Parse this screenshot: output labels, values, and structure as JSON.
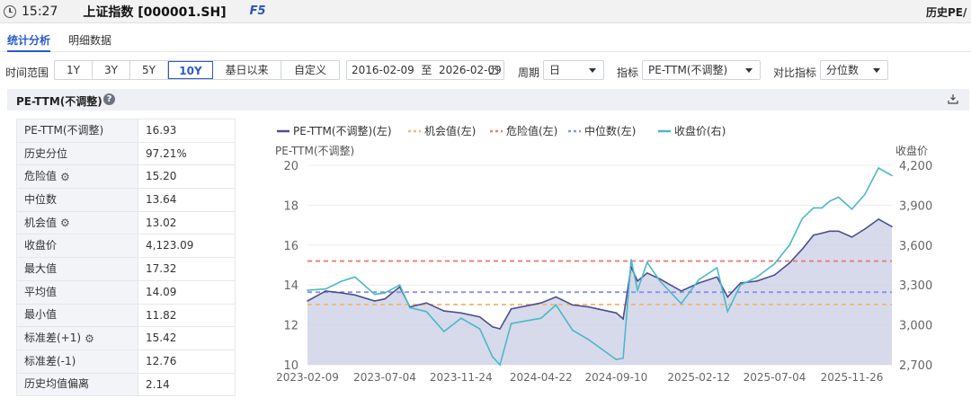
{
  "titlebar": {
    "time": "15:27",
    "stock": "上证指数 [000001.SH]",
    "fkey": "F5",
    "right_text": "历史PE/"
  },
  "tabs": [
    {
      "label": "统计分析",
      "active": true
    },
    {
      "label": "明细数据",
      "active": false
    }
  ],
  "filters": {
    "range_label": "时间范围",
    "ranges": [
      {
        "label": "1Y",
        "active": false
      },
      {
        "label": "3Y",
        "active": false
      },
      {
        "label": "5Y",
        "active": false
      },
      {
        "label": "10Y",
        "active": true
      },
      {
        "label": "基日以来",
        "active": false
      },
      {
        "label": "自定义",
        "active": false
      }
    ],
    "date_range": "2016-02-09  至  2026-02-09",
    "period_label": "周期",
    "period_value": "日",
    "indicator_label": "指标",
    "indicator_value": "PE-TTM(不调整)",
    "compare_label": "对比指标",
    "compare_value": "分位数"
  },
  "panel": {
    "title": "PE-TTM(不调整)"
  },
  "stats": [
    {
      "key": "PE-TTM(不调整)",
      "value": "16.93",
      "gear": false
    },
    {
      "key": "历史分位",
      "value": "97.21%",
      "gear": false
    },
    {
      "key": "危险值",
      "value": "15.20",
      "gear": true
    },
    {
      "key": "中位数",
      "value": "13.64",
      "gear": false
    },
    {
      "key": "机会值",
      "value": "13.02",
      "gear": true
    },
    {
      "key": "收盘价",
      "value": "4,123.09",
      "gear": false
    },
    {
      "key": "最大值",
      "value": "17.32",
      "gear": false
    },
    {
      "key": "平均值",
      "value": "14.09",
      "gear": false
    },
    {
      "key": "最小值",
      "value": "11.82",
      "gear": false
    },
    {
      "key": "标准差(+1)",
      "value": "15.42",
      "gear": true
    },
    {
      "key": "标准差(-1)",
      "value": "12.76",
      "gear": false
    },
    {
      "key": "历史均值偏离",
      "value": "2.14",
      "gear": false
    }
  ],
  "chart_data": {
    "type": "line",
    "legend": [
      {
        "name": "PE-TTM(不调整)(左)",
        "color": "#4a4f8f",
        "style": "solid"
      },
      {
        "name": "机会值(左)",
        "color": "#f2b77a",
        "style": "dashed"
      },
      {
        "name": "危险值(左)",
        "color": "#ee7a7a",
        "style": "dashed"
      },
      {
        "name": "中位数(左)",
        "color": "#8892e6",
        "style": "dashed"
      },
      {
        "name": "收盘价(右)",
        "color": "#4bb8c8",
        "style": "solid"
      }
    ],
    "ylabel_left": "PE-TTM(不调整)",
    "ylabel_right": "收盘价",
    "ylim_left": [
      10,
      20
    ],
    "yticks_left": [
      "20",
      "18",
      "16",
      "14",
      "12",
      "10"
    ],
    "ylim_right": [
      2700,
      4200
    ],
    "yticks_right": [
      "4,200",
      "3,900",
      "3,600",
      "3,300",
      "3,000",
      "2,700"
    ],
    "xticks": [
      "2023-02-09",
      "2023-07-04",
      "2023-11-24",
      "2024-04-22",
      "2024-09-10",
      "2025-02-12",
      "2025-07-04",
      "2025-11-26"
    ],
    "x_start": "2023-02-09",
    "x_end": "2026-02-09",
    "hlines": {
      "机会值": 13.02,
      "危险值": 15.2,
      "中位数": 13.64
    },
    "series": [
      {
        "name": "PE-TTM(不调整)(左)",
        "axis": "left",
        "points": [
          [
            "2023-02-09",
            13.2
          ],
          [
            "2023-03-15",
            13.7
          ],
          [
            "2023-04-15",
            13.6
          ],
          [
            "2023-05-09",
            13.5
          ],
          [
            "2023-06-15",
            13.2
          ],
          [
            "2023-07-04",
            13.3
          ],
          [
            "2023-08-01",
            13.9
          ],
          [
            "2023-08-20",
            12.9
          ],
          [
            "2023-09-20",
            13.1
          ],
          [
            "2023-10-23",
            12.7
          ],
          [
            "2023-11-24",
            12.6
          ],
          [
            "2023-12-29",
            12.4
          ],
          [
            "2024-01-22",
            11.9
          ],
          [
            "2024-02-05",
            11.8
          ],
          [
            "2024-02-26",
            12.8
          ],
          [
            "2024-04-22",
            13.1
          ],
          [
            "2024-05-20",
            13.4
          ],
          [
            "2024-06-20",
            13.0
          ],
          [
            "2024-07-20",
            12.9
          ],
          [
            "2024-09-10",
            12.6
          ],
          [
            "2024-09-23",
            12.3
          ],
          [
            "2024-10-08",
            14.9
          ],
          [
            "2024-10-20",
            14.2
          ],
          [
            "2024-11-07",
            14.6
          ],
          [
            "2024-12-01",
            14.3
          ],
          [
            "2025-01-10",
            13.7
          ],
          [
            "2025-02-12",
            14.1
          ],
          [
            "2025-03-18",
            14.4
          ],
          [
            "2025-04-07",
            13.4
          ],
          [
            "2025-05-01",
            14.1
          ],
          [
            "2025-06-01",
            14.2
          ],
          [
            "2025-07-04",
            14.5
          ],
          [
            "2025-08-01",
            15.1
          ],
          [
            "2025-08-25",
            15.8
          ],
          [
            "2025-09-15",
            16.5
          ],
          [
            "2025-10-01",
            16.6
          ],
          [
            "2025-10-15",
            16.7
          ],
          [
            "2025-11-01",
            16.7
          ],
          [
            "2025-11-26",
            16.4
          ],
          [
            "2025-12-20",
            16.8
          ],
          [
            "2026-01-15",
            17.3
          ],
          [
            "2026-02-09",
            16.93
          ]
        ]
      },
      {
        "name": "收盘价(右)",
        "axis": "right",
        "points": [
          [
            "2023-02-09",
            3260
          ],
          [
            "2023-03-15",
            3270
          ],
          [
            "2023-04-15",
            3330
          ],
          [
            "2023-05-09",
            3360
          ],
          [
            "2023-06-15",
            3230
          ],
          [
            "2023-07-04",
            3240
          ],
          [
            "2023-08-01",
            3300
          ],
          [
            "2023-08-20",
            3130
          ],
          [
            "2023-09-20",
            3100
          ],
          [
            "2023-10-23",
            2950
          ],
          [
            "2023-11-24",
            3050
          ],
          [
            "2023-12-29",
            2970
          ],
          [
            "2024-01-22",
            2760
          ],
          [
            "2024-02-05",
            2700
          ],
          [
            "2024-02-26",
            3010
          ],
          [
            "2024-04-22",
            3050
          ],
          [
            "2024-05-20",
            3150
          ],
          [
            "2024-06-20",
            2960
          ],
          [
            "2024-07-20",
            2890
          ],
          [
            "2024-09-10",
            2740
          ],
          [
            "2024-09-23",
            2750
          ],
          [
            "2024-10-08",
            3490
          ],
          [
            "2024-10-20",
            3260
          ],
          [
            "2024-11-07",
            3470
          ],
          [
            "2024-12-01",
            3330
          ],
          [
            "2025-01-10",
            3160
          ],
          [
            "2025-02-12",
            3340
          ],
          [
            "2025-03-18",
            3430
          ],
          [
            "2025-04-07",
            3100
          ],
          [
            "2025-05-01",
            3300
          ],
          [
            "2025-06-01",
            3360
          ],
          [
            "2025-07-04",
            3460
          ],
          [
            "2025-08-01",
            3600
          ],
          [
            "2025-08-25",
            3800
          ],
          [
            "2025-09-15",
            3880
          ],
          [
            "2025-10-01",
            3880
          ],
          [
            "2025-10-15",
            3930
          ],
          [
            "2025-11-01",
            3960
          ],
          [
            "2025-11-26",
            3870
          ],
          [
            "2025-12-20",
            3980
          ],
          [
            "2026-01-15",
            4180
          ],
          [
            "2026-02-09",
            4123
          ]
        ]
      }
    ]
  }
}
